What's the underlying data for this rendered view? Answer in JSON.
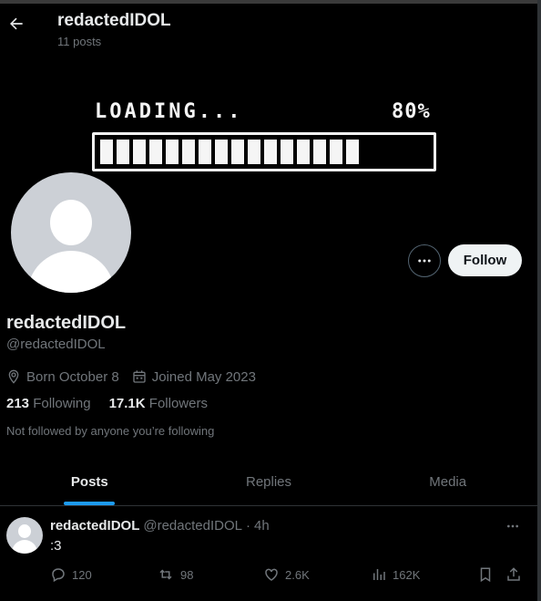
{
  "header": {
    "title": "redactedIDOL",
    "post_count": "11 posts"
  },
  "banner": {
    "loading_label": "LOADING...",
    "percent_label": "80%",
    "progress": 0.8
  },
  "profile": {
    "display_name": "redactedIDOL",
    "handle": "@redactedIDOL",
    "born": "Born October 8",
    "joined": "Joined May 2023",
    "following_count": "213",
    "following_label": "Following",
    "followers_count": "17.1K",
    "followers_label": "Followers",
    "not_followed_text": "Not followed by anyone you’re following",
    "follow_button": "Follow"
  },
  "tabs": [
    {
      "label": "Posts",
      "active": true
    },
    {
      "label": "Replies",
      "active": false
    },
    {
      "label": "Media",
      "active": false
    }
  ],
  "tweet": {
    "name": "redactedIDOL",
    "handle": "@redactedIDOL",
    "separator": "·",
    "time": "4h",
    "text": ":3",
    "replies": "120",
    "reposts": "98",
    "likes": "2.6K",
    "views": "162K"
  },
  "colors": {
    "background": "#000000",
    "accent": "#1d9bf0",
    "muted_text": "#71767b",
    "primary_text": "#e7e9ea"
  }
}
